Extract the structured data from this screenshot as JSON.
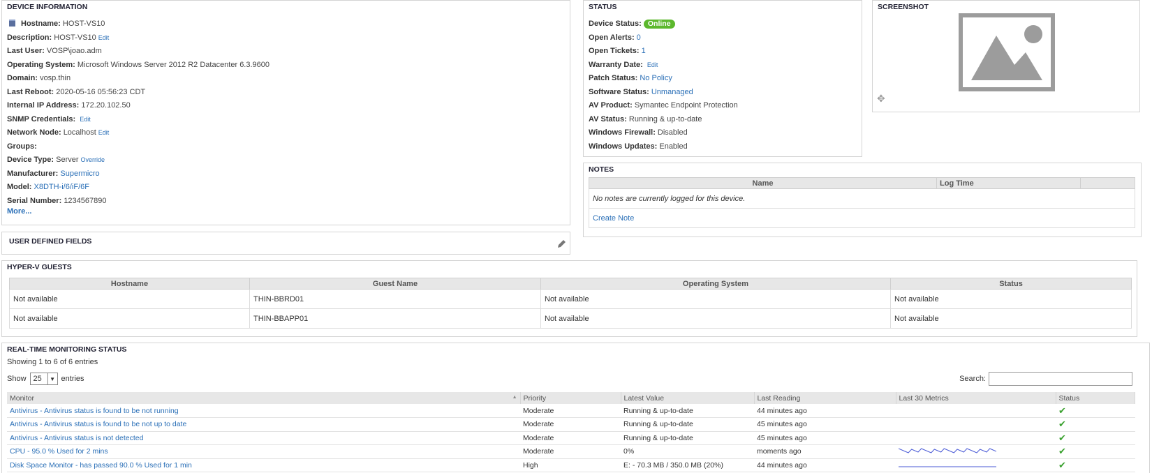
{
  "device_info": {
    "title": "DEVICE INFORMATION",
    "fields": [
      {
        "label": "Hostname:",
        "value": "HOST-VS10"
      },
      {
        "label": "Description:",
        "value": "HOST-VS10",
        "edit": "Edit"
      },
      {
        "label": "Last User:",
        "value": "VOSP\\joao.adm"
      },
      {
        "label": "Operating System:",
        "value": "Microsoft Windows Server 2012 R2 Datacenter 6.3.9600"
      },
      {
        "label": "Domain:",
        "value": "vosp.thin"
      },
      {
        "label": "Last Reboot:",
        "value": "2020-05-16 05:56:23 CDT"
      },
      {
        "label": "Internal IP Address:",
        "value": "172.20.102.50"
      },
      {
        "label": "SNMP Credentials:",
        "value": "",
        "edit": "Edit"
      },
      {
        "label": "Network Node:",
        "value": "Localhost",
        "edit": "Edit"
      },
      {
        "label": "Groups:",
        "value": ""
      },
      {
        "label": "Device Type:",
        "value": "Server",
        "edit": "Override"
      },
      {
        "label": "Manufacturer:",
        "value": "Supermicro",
        "link": true
      },
      {
        "label": "Model:",
        "value": "X8DTH-i/6/iF/6F",
        "link": true
      },
      {
        "label": "Serial Number:",
        "value": "1234567890"
      }
    ],
    "more": "More..."
  },
  "status": {
    "title": "STATUS",
    "device_status_label": "Device Status:",
    "device_status_value": "Online",
    "fields": [
      {
        "label": "Open Alerts:",
        "value": "0",
        "link": true
      },
      {
        "label": "Open Tickets:",
        "value": "1",
        "link": true
      },
      {
        "label": "Warranty Date:",
        "value": "",
        "edit": "Edit"
      },
      {
        "label": "Patch Status:",
        "value": "No Policy",
        "link": true
      },
      {
        "label": "Software Status:",
        "value": "Unmanaged",
        "link": true
      },
      {
        "label": "AV Product:",
        "value": "Symantec Endpoint Protection"
      },
      {
        "label": "AV Status:",
        "value": "Running & up-to-date"
      },
      {
        "label": "Windows Firewall:",
        "value": "Disabled"
      },
      {
        "label": "Windows Updates:",
        "value": "Enabled"
      }
    ]
  },
  "screenshot": {
    "title": "SCREENSHOT"
  },
  "notes": {
    "title": "NOTES",
    "columns": [
      "Name",
      "Log Time",
      ""
    ],
    "empty_text": "No notes are currently logged for this device.",
    "create_link": "Create Note"
  },
  "udf": {
    "title": "USER DEFINED FIELDS"
  },
  "hyperv": {
    "title": "HYPER-V GUESTS",
    "columns": [
      "Hostname",
      "Guest Name",
      "Operating System",
      "Status"
    ],
    "rows": [
      [
        "Not available",
        "THIN-BBRD01",
        "Not available",
        "Not available"
      ],
      [
        "Not available",
        "THIN-BBAPP01",
        "Not available",
        "Not available"
      ]
    ]
  },
  "monitoring": {
    "title": "REAL-TIME MONITORING STATUS",
    "showing": "Showing 1 to 6 of 6 entries",
    "show_label": "Show",
    "page_size": "25",
    "entries_label": "entries",
    "search_label": "Search:",
    "search_value": "",
    "columns": [
      "Monitor",
      "Priority",
      "Latest Value",
      "Last Reading",
      "Last 30 Metrics",
      "Status"
    ],
    "rows": [
      {
        "monitor": "Antivirus - Antivirus status is found to be not running",
        "priority": "Moderate",
        "latest": "Running & up-to-date",
        "reading": "44 minutes ago",
        "spark": "none"
      },
      {
        "monitor": "Antivirus - Antivirus status is found to be not up to date",
        "priority": "Moderate",
        "latest": "Running & up-to-date",
        "reading": "45 minutes ago",
        "spark": "none"
      },
      {
        "monitor": "Antivirus - Antivirus status is not detected",
        "priority": "Moderate",
        "latest": "Running & up-to-date",
        "reading": "45 minutes ago",
        "spark": "none"
      },
      {
        "monitor": "CPU - 95.0 % Used for 2 mins",
        "priority": "Moderate",
        "latest": "0%",
        "reading": "moments ago",
        "spark": "wave"
      },
      {
        "monitor": "Disk Space Monitor - has passed 90.0 % Used for 1 min",
        "priority": "High",
        "latest": "E: - 70.3 MB / 350.0 MB (20%)",
        "reading": "44 minutes ago",
        "spark": "flat"
      }
    ]
  },
  "colors": {
    "link": "#2a6fb7",
    "online": "#5cb82d",
    "check": "#3aa12f"
  }
}
